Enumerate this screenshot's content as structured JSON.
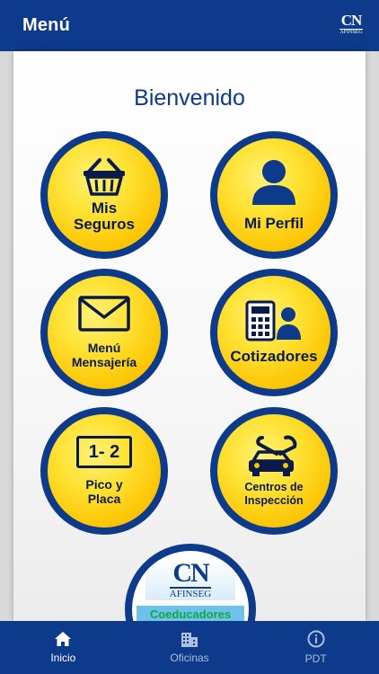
{
  "appbar": {
    "title": "Menú",
    "logo_text": "CN",
    "logo_sub": "AFINSEG"
  },
  "welcome": "Bienvenido",
  "tiles": [
    {
      "label1": "Mis",
      "label2": "Seguros",
      "icon": "shopping-basket-icon"
    },
    {
      "label1": "Mi Perfil",
      "label2": "",
      "icon": "user-icon"
    },
    {
      "label1": "Menú",
      "label2": "Mensajería",
      "icon": "envelope-icon"
    },
    {
      "label1": "Cotizadores",
      "label2": "",
      "icon": "calculator-user-icon"
    },
    {
      "label1": "Pico y",
      "label2": "Placa",
      "icon": "license-plate-icon",
      "plate": "1- 2"
    },
    {
      "label1": "Centros de",
      "label2": "Inspección",
      "icon": "car-wrench-icon"
    }
  ],
  "coeducadores": {
    "logo_text": "CN",
    "logo_sub": "AFINSEG",
    "label": "Coeducadores"
  },
  "tabs": [
    {
      "label": "Inicio",
      "icon": "home-icon",
      "active": true
    },
    {
      "label": "Oficinas",
      "icon": "building-icon",
      "active": false
    },
    {
      "label": "PDT",
      "icon": "info-icon",
      "active": false
    }
  ],
  "colors": {
    "primary": "#0d3a8a",
    "tile_yellow": "#fcc300",
    "text_dark": "#0a1a4a"
  }
}
